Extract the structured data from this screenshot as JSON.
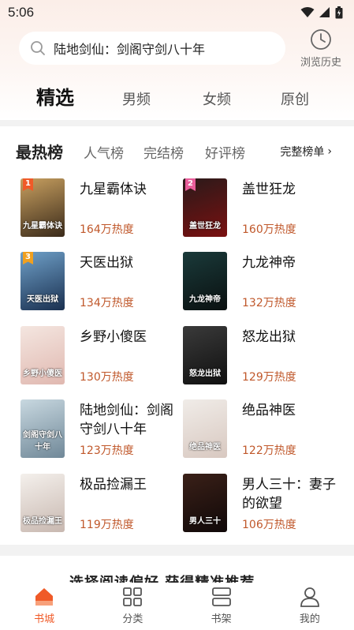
{
  "status": {
    "time": "5:06"
  },
  "search": {
    "text": "陆地剑仙：剑阁守剑八十年"
  },
  "history": {
    "label": "浏览历史"
  },
  "top_tabs": [
    {
      "label": "精选",
      "active": true
    },
    {
      "label": "男频",
      "active": false
    },
    {
      "label": "女频",
      "active": false
    },
    {
      "label": "原创",
      "active": false
    }
  ],
  "rank_tabs": [
    {
      "label": "最热榜",
      "active": true
    },
    {
      "label": "人气榜",
      "active": false
    },
    {
      "label": "完结榜",
      "active": false
    },
    {
      "label": "好评榜",
      "active": false
    }
  ],
  "full_list": {
    "label": "完整榜单"
  },
  "books": [
    {
      "rank": "1",
      "title": "九星霸体诀",
      "heat": "164万热度",
      "cover_text": "九星霸体诀",
      "badge_color": "#f05a28",
      "cover_colors": [
        "#c8a060",
        "#3a2a1a"
      ]
    },
    {
      "rank": "2",
      "title": "盖世狂龙",
      "heat": "160万热度",
      "cover_text": "盖世狂龙",
      "badge_color": "#e85d9a",
      "cover_colors": [
        "#2a1a1a",
        "#7a1010"
      ]
    },
    {
      "rank": "3",
      "title": "天医出狱",
      "heat": "134万热度",
      "cover_text": "天医出狱",
      "badge_color": "#f0a020",
      "cover_colors": [
        "#6fa0c8",
        "#1a3050"
      ]
    },
    {
      "rank": "",
      "title": "九龙神帝",
      "heat": "132万热度",
      "cover_text": "九龙神帝",
      "badge_color": "",
      "cover_colors": [
        "#1a3a3a",
        "#0a1010"
      ]
    },
    {
      "rank": "",
      "title": "乡野小傻医",
      "heat": "130万热度",
      "cover_text": "乡野小傻医",
      "badge_color": "",
      "cover_colors": [
        "#f4e6e0",
        "#e0b8b0"
      ]
    },
    {
      "rank": "",
      "title": "怒龙出狱",
      "heat": "129万热度",
      "cover_text": "怒龙出狱",
      "badge_color": "",
      "cover_colors": [
        "#3a3a3a",
        "#101010"
      ]
    },
    {
      "rank": "",
      "title": "陆地剑仙：剑阁守剑八十年",
      "heat": "123万热度",
      "cover_text": "剑阁守剑八十年",
      "badge_color": "",
      "cover_colors": [
        "#c8d8e0",
        "#708898"
      ]
    },
    {
      "rank": "",
      "title": "绝品神医",
      "heat": "122万热度",
      "cover_text": "绝品神医",
      "badge_color": "",
      "cover_colors": [
        "#f0ece8",
        "#d8c8c0"
      ]
    },
    {
      "rank": "",
      "title": "极品捡漏王",
      "heat": "119万热度",
      "cover_text": "极品捡漏王",
      "badge_color": "",
      "cover_colors": [
        "#f4f0ec",
        "#c8b8b0"
      ]
    },
    {
      "rank": "",
      "title": "男人三十：妻子的欲望",
      "heat": "106万热度",
      "cover_text": "男人三十",
      "badge_color": "",
      "cover_colors": [
        "#3a2018",
        "#100808"
      ]
    }
  ],
  "promo": {
    "text": "选择阅读偏好 获得精准推荐"
  },
  "nav": [
    {
      "label": "书城",
      "icon": "bookstore-icon",
      "active": true
    },
    {
      "label": "分类",
      "icon": "category-icon",
      "active": false
    },
    {
      "label": "书架",
      "icon": "bookshelf-icon",
      "active": false
    },
    {
      "label": "我的",
      "icon": "profile-icon",
      "active": false
    }
  ],
  "colors": {
    "accent": "#f05a28",
    "heat": "#c0582b"
  }
}
